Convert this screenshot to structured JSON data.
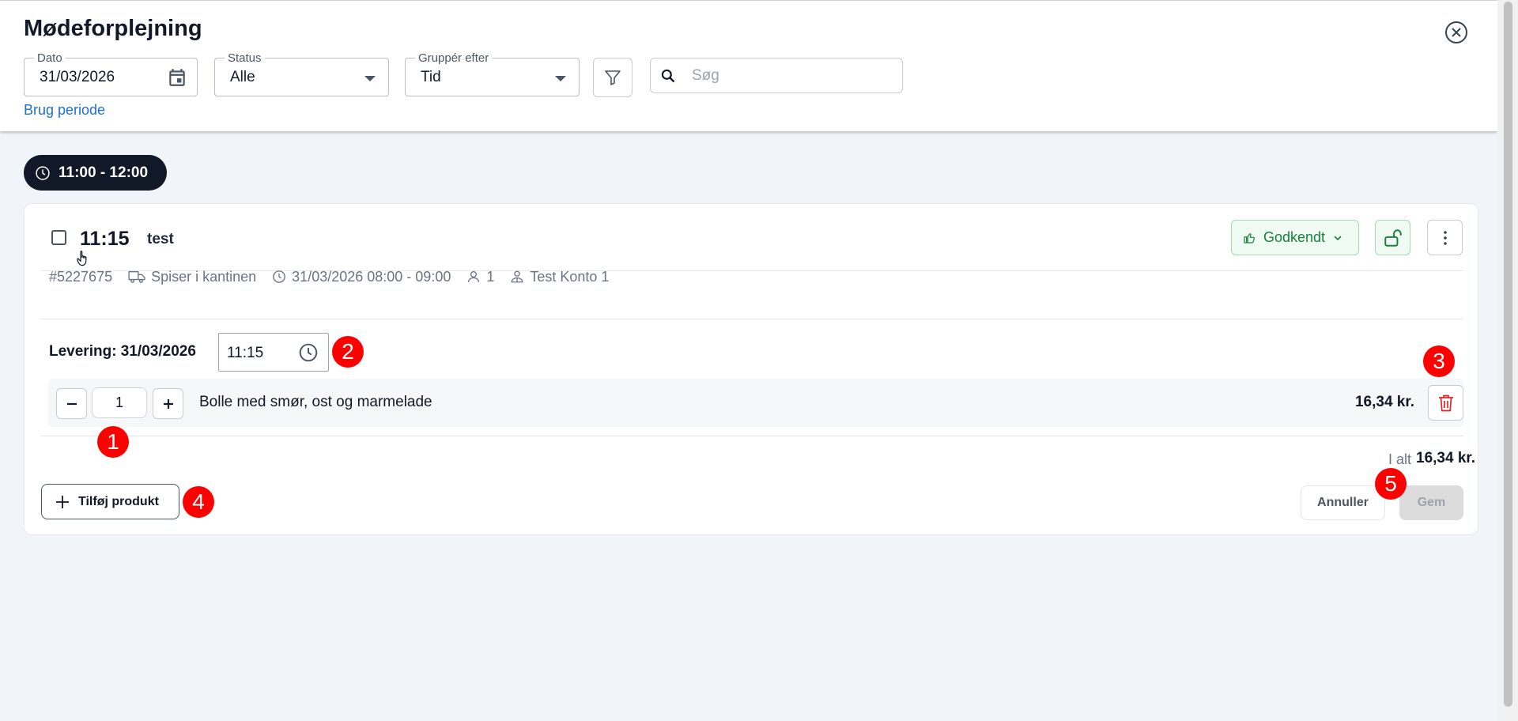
{
  "header": {
    "title": "Mødeforplejning",
    "date_field": {
      "label": "Dato",
      "value": "31/03/2026"
    },
    "status_field": {
      "label": "Status",
      "value": "Alle"
    },
    "group_field": {
      "label": "Gruppér efter",
      "value": "Tid"
    },
    "search": {
      "placeholder": "Søg",
      "value": ""
    },
    "period_link": "Brug periode"
  },
  "slot": {
    "label": "11:00 - 12:00"
  },
  "order": {
    "time": "11:15",
    "name": "test",
    "status_label": "Godkendt",
    "meta": {
      "id": "#5227675",
      "location": "Spiser i kantinen",
      "datetime": "31/03/2026 08:00 - 09:00",
      "persons": "1",
      "account": "Test Konto 1"
    },
    "delivery_label": "Levering: 31/03/2026",
    "delivery_time": "11:15",
    "products": [
      {
        "quantity": "1",
        "name": "Bolle med smør, ost og marmelade",
        "price": "16,34 kr."
      }
    ],
    "total_label": "I alt",
    "total_value": "16,34 kr.",
    "add_product_label": "Tilføj produkt",
    "cancel_label": "Annuller",
    "save_label": "Gem"
  },
  "markers": [
    "1",
    "2",
    "3",
    "4",
    "5"
  ],
  "colors": {
    "accent_link": "#1d6fd1",
    "approved_green": "#1a7f3e",
    "delete_red": "#dc2626",
    "marker_red": "#ff0000",
    "chip_dark": "#111827"
  },
  "icons": [
    "close-icon",
    "calendar-icon",
    "filter-icon",
    "search-icon",
    "clock-icon",
    "thumbs-up-icon",
    "chevron-down-icon",
    "unlock-icon",
    "more-vertical-icon",
    "truck-icon",
    "person-icon",
    "account-icon",
    "minus-icon",
    "plus-icon",
    "trash-icon",
    "hand-cursor-icon"
  ]
}
